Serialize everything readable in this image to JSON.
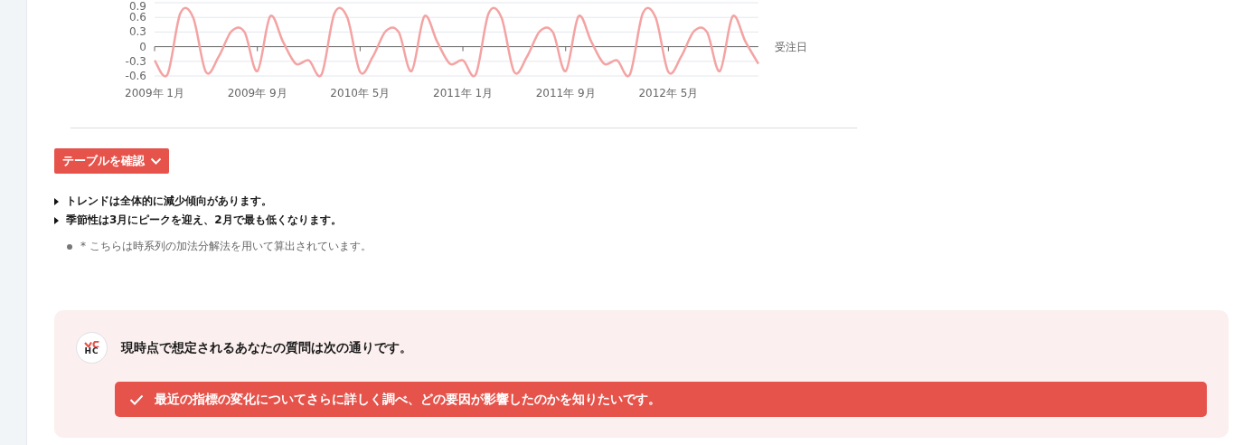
{
  "chart": {
    "chart_data": {
      "type": "line",
      "grid": true,
      "xlabel": "受注日",
      "categories": [
        "2009年 1月",
        null,
        null,
        null,
        null,
        null,
        null,
        null,
        "2009年 9月",
        null,
        null,
        null,
        null,
        null,
        null,
        null,
        "2010年 5月",
        null,
        null,
        null,
        null,
        null,
        null,
        null,
        "2011年 1月",
        null,
        null,
        null,
        null,
        null,
        null,
        null,
        "2011年 9月",
        null,
        null,
        null,
        null,
        null,
        null,
        null,
        "2012年 5月",
        null,
        null,
        null,
        null,
        null,
        null,
        null
      ],
      "series": [
        {
          "color": "#f4a3a3",
          "values": [
            -0.28,
            -0.57,
            0.68,
            0.6,
            -0.52,
            -0.2,
            0.32,
            0.3,
            -0.5,
            0.62,
            0.1,
            -0.35,
            -0.28,
            -0.57,
            0.68,
            0.6,
            -0.52,
            -0.2,
            0.32,
            0.3,
            -0.5,
            0.62,
            0.1,
            -0.35,
            -0.28,
            -0.57,
            0.68,
            0.6,
            -0.52,
            -0.2,
            0.32,
            0.3,
            -0.5,
            0.62,
            0.1,
            -0.35,
            -0.28,
            -0.57,
            0.68,
            0.6,
            -0.52,
            -0.2,
            0.32,
            0.3,
            -0.5,
            0.62,
            0.1,
            -0.35
          ]
        }
      ],
      "ylim": [
        -0.6,
        0.9
      ],
      "yticks": [
        {
          "value": -0.6,
          "label": "-0.6"
        },
        {
          "value": -0.3,
          "label": "-0.3"
        },
        {
          "value": 0,
          "label": "0"
        },
        {
          "value": 0.3,
          "label": "0.3"
        },
        {
          "value": 0.6,
          "label": "0.6"
        },
        {
          "value": 0.9,
          "label": "0.9"
        }
      ]
    }
  },
  "table_toggle": {
    "label": "テーブルを確認",
    "expanded": false
  },
  "findings": [
    "トレンドは全体的に減少傾向があります。",
    "季節性は3月にピークを迎え、2月で最も低くなります。"
  ],
  "notes": [
    "* こちらは時系列の加法分解法を用いて算出されています。"
  ],
  "assistant": {
    "avatar_text": "HC",
    "message": "現時点で想定されるあなたの質問は次の通りです。",
    "questions": [
      {
        "text": "最近の指標の変化についてさらに詳しく調べ、どの要因が影響したのかを知りたいです。",
        "selected": true
      }
    ]
  }
}
